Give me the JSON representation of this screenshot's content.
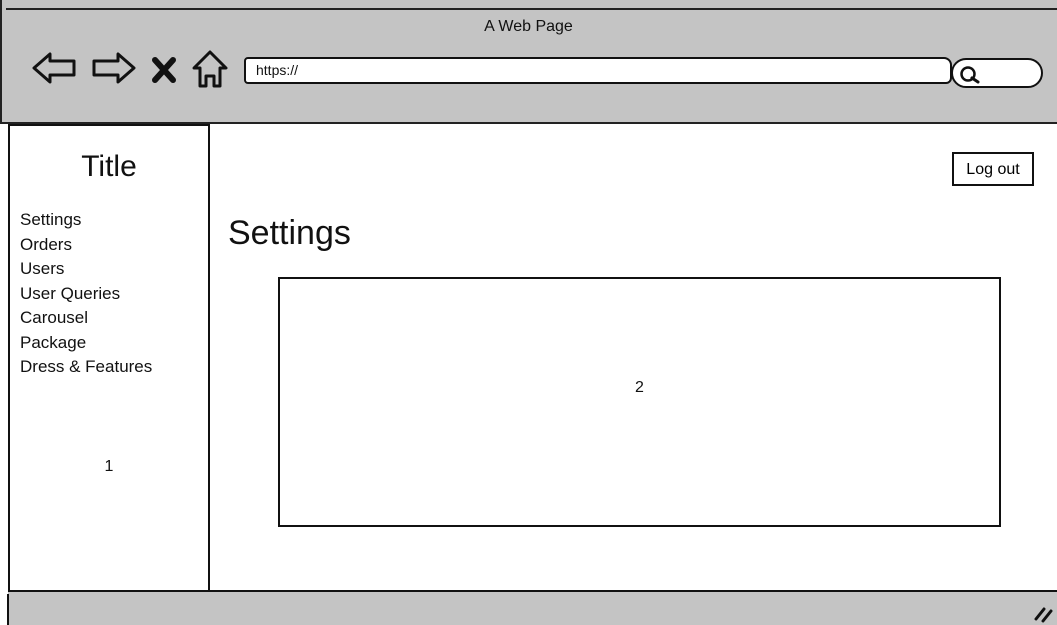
{
  "window": {
    "title": "A Web Page",
    "url": "https://"
  },
  "toolbar": {
    "icons": [
      "back-arrow-icon",
      "forward-arrow-icon",
      "close-x-icon",
      "home-icon",
      "search-icon"
    ]
  },
  "sidebar": {
    "title": "Title",
    "items": [
      {
        "label": "Settings"
      },
      {
        "label": "Orders"
      },
      {
        "label": "Users"
      },
      {
        "label": "User Queries"
      },
      {
        "label": "Carousel"
      },
      {
        "label": "Package"
      },
      {
        "label": "Dress & Features"
      }
    ],
    "marker": "1"
  },
  "header": {
    "logout_label": "Log out"
  },
  "main": {
    "heading": "Settings",
    "content_marker": "2"
  },
  "colors": {
    "chrome": "#c4c4c4",
    "stroke": "#111111",
    "background": "#ffffff"
  }
}
